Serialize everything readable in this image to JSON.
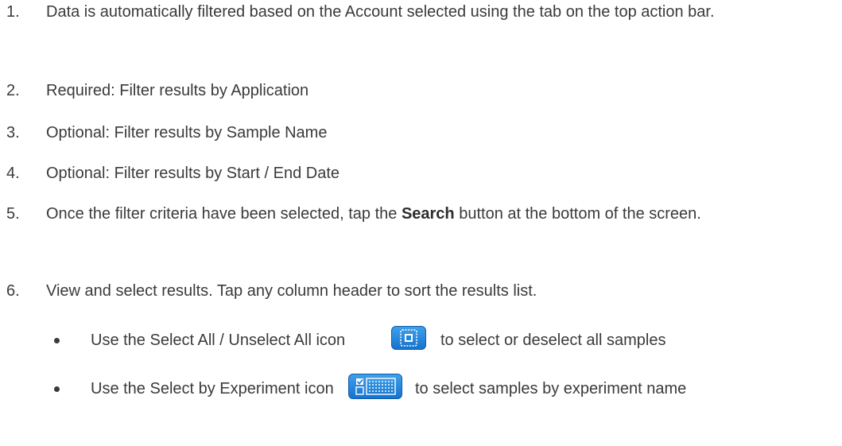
{
  "steps": [
    {
      "num": "1.",
      "text": "Data is automatically filtered based on the Account selected using the tab on the top action bar."
    },
    {
      "num": "2.",
      "text": "Required: Filter results by Application"
    },
    {
      "num": "3.",
      "text": "Optional: Filter results by Sample Name"
    },
    {
      "num": "4.",
      "text": "Optional: Filter results by Start / End Date"
    },
    {
      "num": "5.",
      "text_before": "Once the filter criteria have been selected, tap the ",
      "bold": "Search",
      "text_after": " button at the bottom of the screen."
    },
    {
      "num": "6.",
      "text": "View and select results. Tap any column header to sort the results list."
    }
  ],
  "bullets": [
    {
      "before": "Use the Select All / Unselect All icon",
      "icon": "select-all-icon",
      "after": "to select or deselect all samples"
    },
    {
      "before": "Use the Select by Experiment icon",
      "icon": "select-by-experiment-icon",
      "after": "to select samples by experiment name"
    }
  ],
  "colors": {
    "text": "#3a3a3a",
    "icon_blue": "#1f86df"
  }
}
